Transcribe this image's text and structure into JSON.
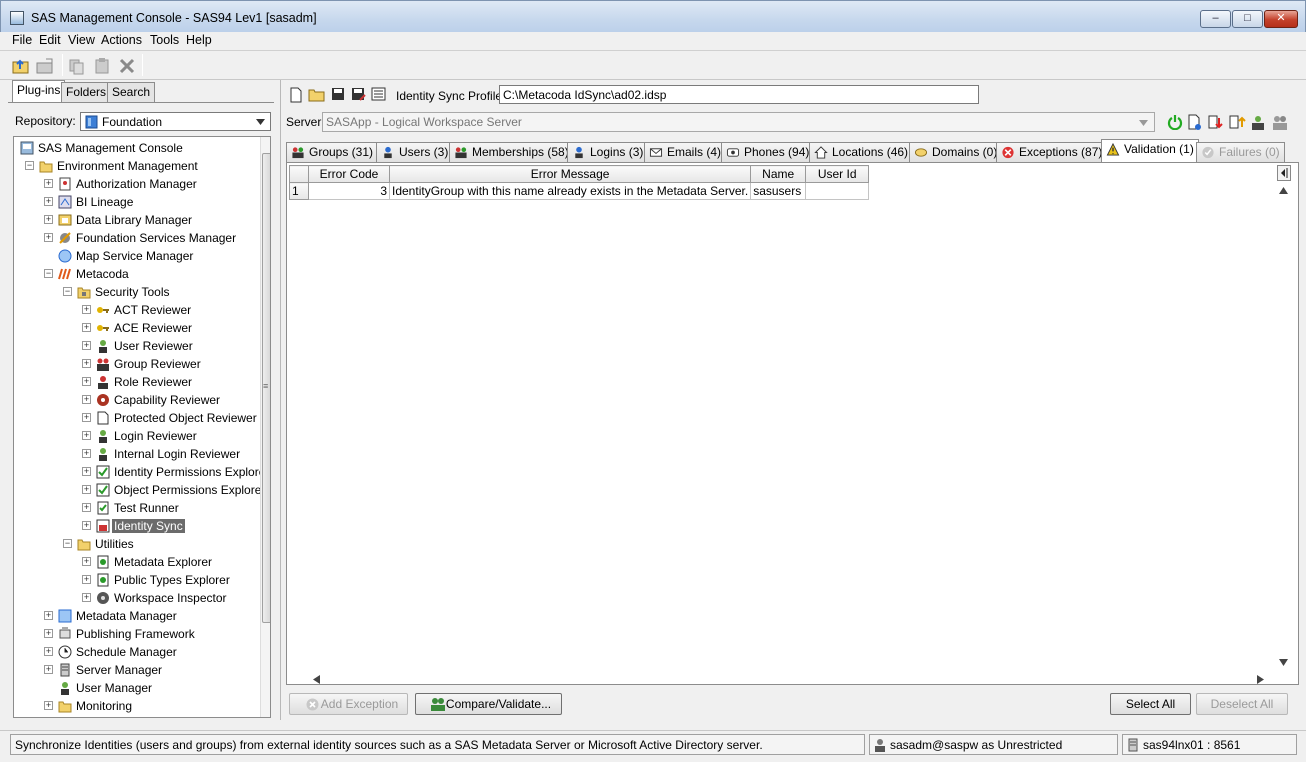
{
  "window": {
    "title": "SAS Management Console - SAS94 Lev1 [sasadm]",
    "minimize_glyph": "–",
    "maximize_glyph": "□",
    "close_glyph": "✕"
  },
  "menu": [
    "File",
    "Edit",
    "View",
    "Actions",
    "Tools",
    "Help"
  ],
  "left": {
    "tabs": [
      "Plug-ins",
      "Folders",
      "Search"
    ],
    "repository_label": "Repository:",
    "repository_value": "Foundation",
    "tree": [
      {
        "label": "SAS Management Console"
      },
      {
        "label": "Environment Management"
      },
      {
        "label": "Authorization Manager"
      },
      {
        "label": "BI Lineage"
      },
      {
        "label": "Data Library Manager"
      },
      {
        "label": "Foundation Services Manager"
      },
      {
        "label": "Map Service Manager"
      },
      {
        "label": "Metacoda"
      },
      {
        "label": "Security Tools"
      },
      {
        "label": "ACT Reviewer"
      },
      {
        "label": "ACE Reviewer"
      },
      {
        "label": "User Reviewer"
      },
      {
        "label": "Group Reviewer"
      },
      {
        "label": "Role Reviewer"
      },
      {
        "label": "Capability Reviewer"
      },
      {
        "label": "Protected Object Reviewer"
      },
      {
        "label": "Login Reviewer"
      },
      {
        "label": "Internal Login Reviewer"
      },
      {
        "label": "Identity Permissions Explorer"
      },
      {
        "label": "Object Permissions Explorer"
      },
      {
        "label": "Test Runner"
      },
      {
        "label": "Identity Sync"
      },
      {
        "label": "Utilities"
      },
      {
        "label": "Metadata Explorer"
      },
      {
        "label": "Public Types Explorer"
      },
      {
        "label": "Workspace Inspector"
      },
      {
        "label": "Metadata Manager"
      },
      {
        "label": "Publishing Framework"
      },
      {
        "label": "Schedule Manager"
      },
      {
        "label": "Server Manager"
      },
      {
        "label": "User Manager"
      },
      {
        "label": "Monitoring"
      }
    ]
  },
  "right": {
    "profile_label": "Identity Sync Profile:",
    "profile_value": "C:\\Metacoda IdSync\\ad02.idsp",
    "server_label": "Server:",
    "server_value": "SASApp - Logical Workspace Server",
    "tabs": [
      {
        "label": "Groups (31)"
      },
      {
        "label": "Users (3)"
      },
      {
        "label": "Memberships (58)"
      },
      {
        "label": "Logins (3)"
      },
      {
        "label": "Emails (4)"
      },
      {
        "label": "Phones (94)"
      },
      {
        "label": "Locations (46)"
      },
      {
        "label": "Domains (0)"
      },
      {
        "label": "Exceptions (87)"
      },
      {
        "label": "Validation (1)"
      },
      {
        "label": "Failures (0)"
      }
    ],
    "table": {
      "columns": [
        "Error Code",
        "Error Message",
        "Name",
        "User Id"
      ],
      "rows": [
        {
          "num": "1",
          "code": "3",
          "message": "IdentityGroup with this name already exists in the Metadata Server.",
          "name": "sasusers",
          "userid": ""
        }
      ]
    },
    "buttons": {
      "add_exception": "Add Exception",
      "compare_validate": "Compare/Validate...",
      "select_all": "Select All",
      "deselect_all": "Deselect All"
    }
  },
  "status": {
    "message": "Synchronize Identities (users and groups) from external identity sources such as a SAS Metadata Server or Microsoft Active Directory server.",
    "user": "sasadm@saspw as Unrestricted",
    "server": "sas94lnx01 : 8561"
  },
  "colors": {
    "selected_row": "#6b6b6b",
    "folder": "#f2d16b",
    "warning": "#e8c21a",
    "power": "#22aa22"
  }
}
